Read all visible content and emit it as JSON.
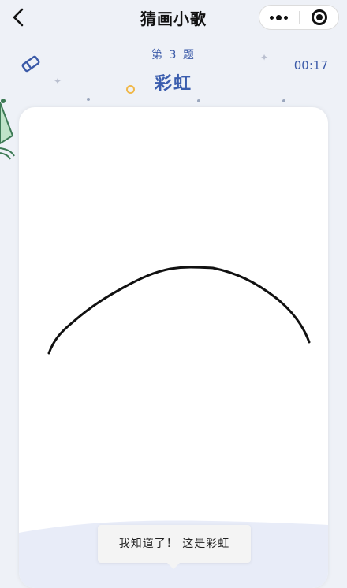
{
  "nav": {
    "title": "猜画小歌",
    "back_icon": "chevron-left-icon",
    "more_icon": "more-dots-icon",
    "close_icon": "target-close-icon"
  },
  "game": {
    "question_label": "第 3 题",
    "answer": "彩虹",
    "timer": "00:17",
    "eraser_icon": "eraser-icon"
  },
  "toast": {
    "message": "我知道了！ 这是彩虹"
  },
  "colors": {
    "accent": "#3b5aa8",
    "background": "#eef1f7",
    "stroke": "#111111"
  }
}
